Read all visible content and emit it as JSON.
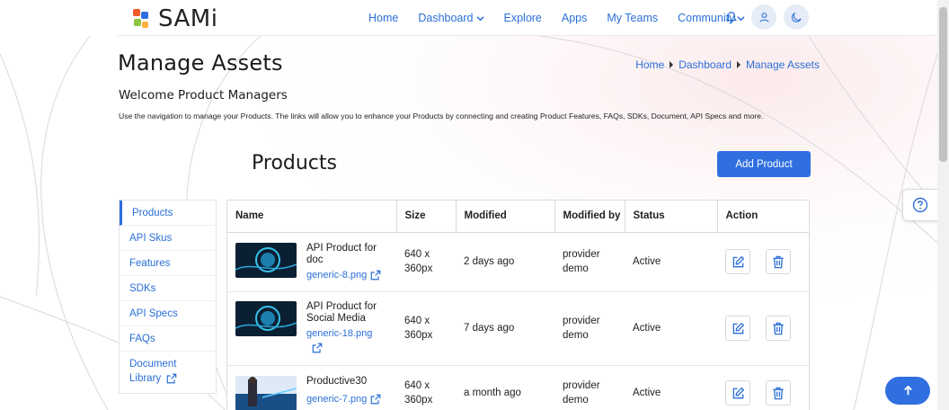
{
  "header": {
    "logo_text": "SAMi",
    "nav": [
      {
        "label": "Home",
        "dropdown": false
      },
      {
        "label": "Dashboard",
        "dropdown": true
      },
      {
        "label": "Explore",
        "dropdown": false
      },
      {
        "label": "Apps",
        "dropdown": false
      },
      {
        "label": "My Teams",
        "dropdown": false
      },
      {
        "label": "Community",
        "dropdown": true
      }
    ],
    "icons": [
      "bell-icon",
      "user-icon",
      "moon-icon"
    ]
  },
  "page": {
    "title": "Manage Assets",
    "breadcrumb": [
      "Home",
      "Dashboard",
      "Manage Assets"
    ],
    "welcome": "Welcome Product Managers",
    "description": "Use the navigation to manage your Products. The links will allow you to enhance your Products by connecting and creating Product Features, FAQs, SDKs, Document, API Specs and more."
  },
  "products": {
    "section_title": "Products",
    "add_label": "Add Product",
    "columns": [
      "Name",
      "Size",
      "Modified",
      "Modified by",
      "Status",
      "Action"
    ],
    "rows": [
      {
        "name_l1": "API Product for",
        "name_l2": "doc",
        "file": "generic-8.png",
        "size_l1": "640 x",
        "size_l2": "360px",
        "modified": "2 days ago",
        "by_l1": "provider",
        "by_l2": "demo",
        "status": "Active"
      },
      {
        "name_l1": "API Product for",
        "name_l2": "Social Media",
        "file": "generic-18.png",
        "size_l1": "640 x",
        "size_l2": "360px",
        "modified": "7 days ago",
        "by_l1": "provider",
        "by_l2": "demo",
        "status": "Active"
      },
      {
        "name_l1": "Productive30",
        "name_l2": "",
        "file": "generic-7.png",
        "size_l1": "640 x",
        "size_l2": "360px",
        "modified": "a month ago",
        "by_l1": "provider",
        "by_l2": "demo",
        "status": "Active"
      }
    ]
  },
  "sidebar": {
    "items": [
      "Products",
      "API Skus",
      "Features",
      "SDKs",
      "API Specs",
      "FAQs"
    ],
    "doc_l1": "Document",
    "doc_l2": "Library"
  },
  "colors": {
    "accent": "#2f6fe0",
    "link": "#2a6fd6"
  }
}
